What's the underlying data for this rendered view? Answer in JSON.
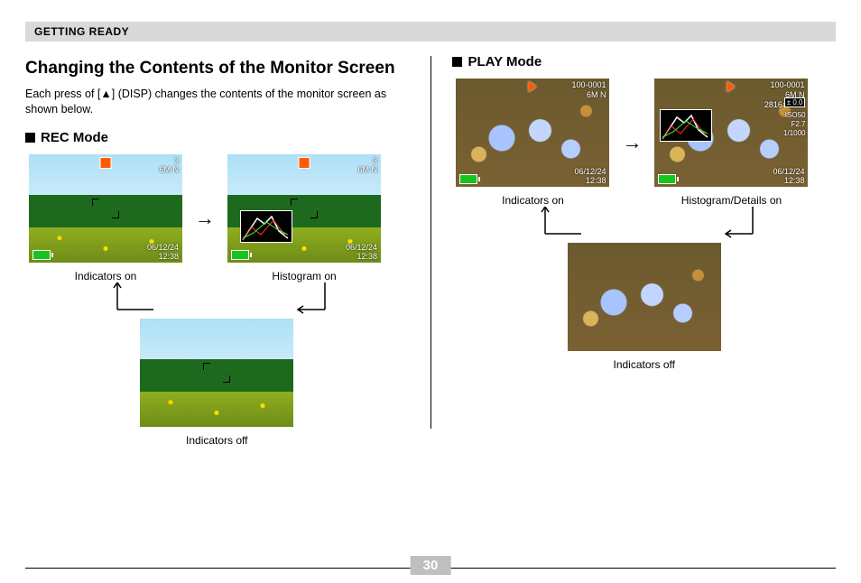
{
  "header": "GETTING READY",
  "title": "Changing the Contents of the Monitor Screen",
  "description": "Each press of [▲] (DISP) changes the contents of the monitor screen as shown below.",
  "rec": {
    "heading": "REC Mode",
    "states": [
      "Indicators on",
      "Histogram on",
      "Indicators off"
    ],
    "hud": {
      "shots": "3",
      "size": "6M N",
      "date": "06/12/24",
      "time": "12:38"
    }
  },
  "play": {
    "heading": "PLAY Mode",
    "states": [
      "Indicators on",
      "Histogram/Details on",
      "Indicators off"
    ],
    "hud": {
      "file": "100-0001",
      "size": "6M N",
      "res": "2816×2112",
      "ev": "± 0.0",
      "iso": "ISO50",
      "f": "F2.7",
      "shutter": "1/1000",
      "date": "06/12/24",
      "time": "12:38"
    }
  },
  "page_number": "30"
}
